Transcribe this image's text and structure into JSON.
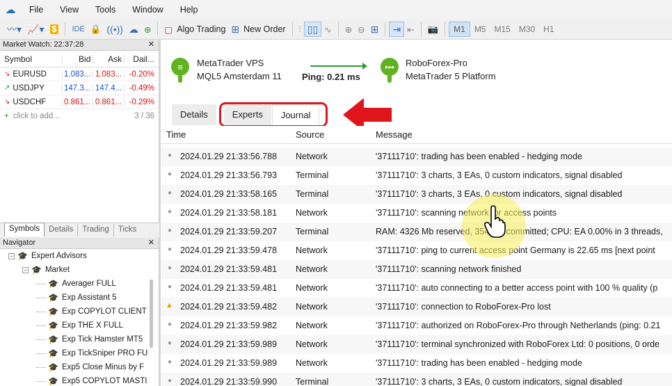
{
  "menu": {
    "items": [
      "File",
      "View",
      "Tools",
      "Window",
      "Help"
    ]
  },
  "toolbar": {
    "algo_trading": "Algo Trading",
    "new_order": "New Order",
    "ide": "IDE",
    "timeframes": [
      "M1",
      "M5",
      "M15",
      "M30",
      "H1"
    ],
    "active_timeframe": "M1"
  },
  "market_watch": {
    "title": "Market Watch: 22:37:28",
    "columns": [
      "Symbol",
      "Bid",
      "Ask",
      "Dail..."
    ],
    "rows": [
      {
        "symbol": "EURUSD",
        "bid": "1.083...",
        "ask": "1.083...",
        "daily": "-0.20%",
        "dir": "down",
        "bid_color": "blue",
        "ask_color": "red"
      },
      {
        "symbol": "USDJPY",
        "bid": "147.3...",
        "ask": "147.4...",
        "daily": "-0.49%",
        "dir": "up",
        "bid_color": "blue",
        "ask_color": "blue"
      },
      {
        "symbol": "USDCHF",
        "bid": "0.861...",
        "ask": "0.861...",
        "daily": "-0.29%",
        "dir": "down",
        "bid_color": "red",
        "ask_color": "red"
      }
    ],
    "add_text": "click to add...",
    "count": "3 / 36",
    "tabs": [
      "Symbols",
      "Details",
      "Trading",
      "Ticks"
    ],
    "active_tab": "Symbols"
  },
  "navigator": {
    "title": "Navigator",
    "root": "Expert Advisors",
    "folder": "Market",
    "items": [
      "Averager FULL",
      "Exp Assistant 5",
      "Exp COPYLOT CLIENT",
      "Exp THE X FULL",
      "Exp Tick Hamster MT5",
      "Exp TickSniper PRO FU",
      "Exp5 Close Minus by F",
      "Exp5 COPYLOT MASTI"
    ]
  },
  "vps": {
    "left_title": "MetaTrader VPS",
    "left_sub": "MQL5 Amsterdam 11",
    "ping": "Ping: 0.21 ms",
    "right_title": "RoboForex-Pro",
    "right_sub": "MetaTrader 5 Platform",
    "accent": "#5fb320"
  },
  "tabs": {
    "items": [
      "Details",
      "Experts",
      "Journal"
    ],
    "active": "Journal"
  },
  "journal": {
    "columns": {
      "time": "Time",
      "source": "Source",
      "message": "Message"
    },
    "rows": [
      {
        "icon": "dot",
        "time": "2024.01.29 21:33:56.788",
        "source": "Network",
        "message": "'37111710': trading has been enabled - hedging mode"
      },
      {
        "icon": "dot",
        "time": "2024.01.29 21:33:56.793",
        "source": "Terminal",
        "message": "'37111710': 3 charts, 3 EAs, 0 custom indicators, signal disabled"
      },
      {
        "icon": "dot",
        "time": "2024.01.29 21:33:58.165",
        "source": "Terminal",
        "message": "'37111710': 3 charts, 3 EAs, 0 custom indicators, signal disabled"
      },
      {
        "icon": "dot",
        "time": "2024.01.29 21:33:58.181",
        "source": "Network",
        "message": "'37111710': scanning network for access points"
      },
      {
        "icon": "dot",
        "time": "2024.01.29 21:33:59.207",
        "source": "Terminal",
        "message": "RAM: 4326 Mb reserved, 354 Mb committed; CPU: EA 0.00% in 3 threads,"
      },
      {
        "icon": "dot",
        "time": "2024.01.29 21:33:59.478",
        "source": "Network",
        "message": "'37111710': ping to current access point Germany is 22.65 ms [next point"
      },
      {
        "icon": "dot",
        "time": "2024.01.29 21:33:59.481",
        "source": "Network",
        "message": "'37111710': scanning network finished"
      },
      {
        "icon": "dot",
        "time": "2024.01.29 21:33:59.481",
        "source": "Network",
        "message": "'37111710': auto connecting to a better access point with 100 % quality (p"
      },
      {
        "icon": "warn",
        "time": "2024.01.29 21:33:59.482",
        "source": "Network",
        "message": "'37111710': connection to RoboForex-Pro lost"
      },
      {
        "icon": "dot",
        "time": "2024.01.29 21:33:59.982",
        "source": "Network",
        "message": "'37111710': authorized on RoboForex-Pro through Netherlands (ping: 0.21"
      },
      {
        "icon": "dot",
        "time": "2024.01.29 21:33:59.989",
        "source": "Network",
        "message": "'37111710': terminal synchronized with RoboForex Ltd: 0 positions, 0 orde"
      },
      {
        "icon": "dot",
        "time": "2024.01.29 21:33:59.989",
        "source": "Network",
        "message": "'37111710': trading has been enabled - hedging mode"
      },
      {
        "icon": "dot",
        "time": "2024.01.29 21:33:59.990",
        "source": "Terminal",
        "message": "'37111710': 3 charts, 3 EAs, 0 custom indicators, signal disabled"
      }
    ]
  },
  "annotation_color": "#e0141b"
}
